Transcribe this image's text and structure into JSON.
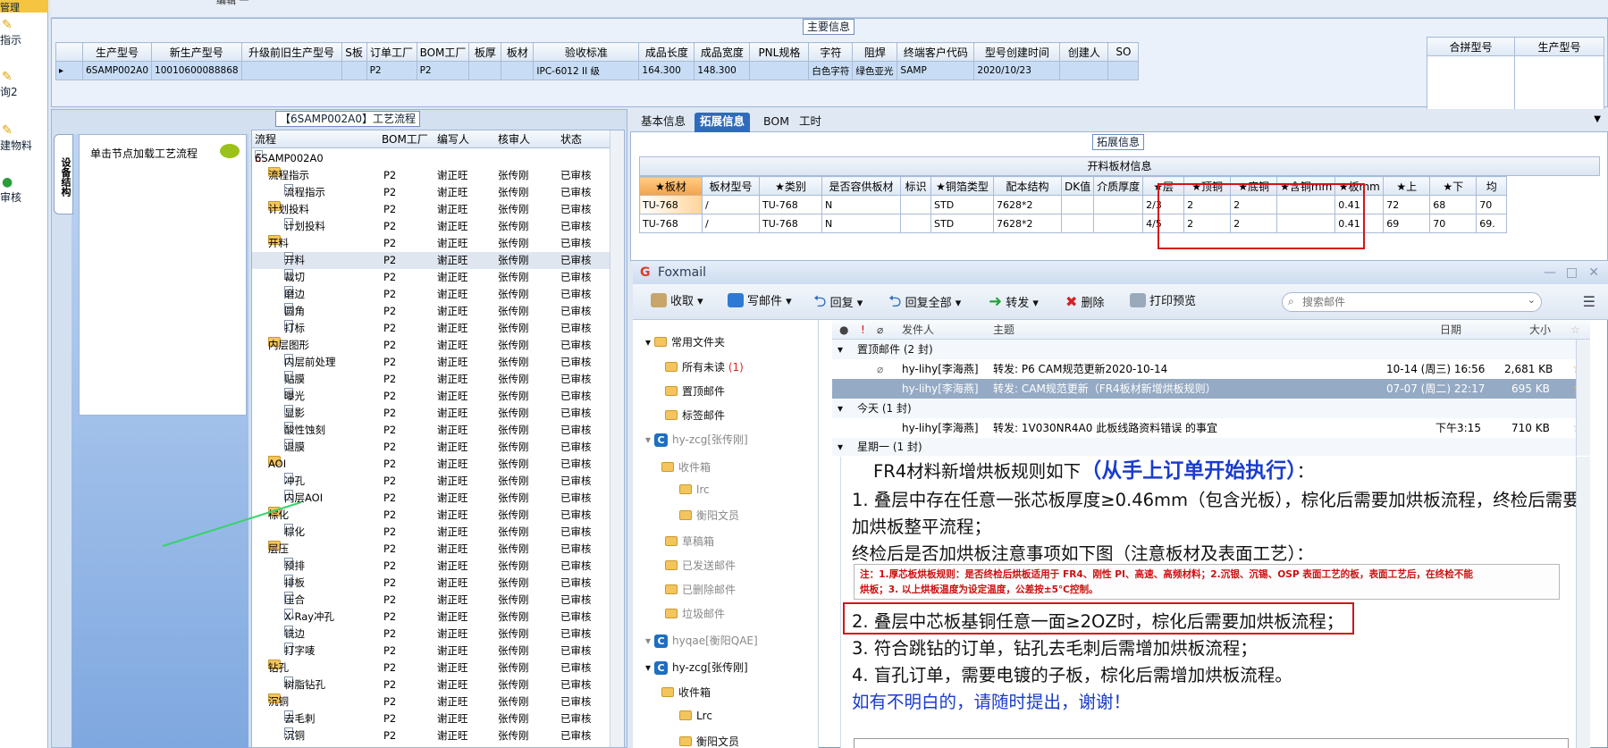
{
  "leftbar": {
    "items": [
      "管理",
      "指示",
      "询2",
      "建物料",
      "审核"
    ]
  },
  "top_sample_text": "编辑 一",
  "main_header": {
    "group_title": "主要信息",
    "columns": [
      "生产型号",
      "新生产型号",
      "升级前旧生产型号",
      "S板",
      "订单工厂",
      "BOM工厂",
      "板厚",
      "板材",
      "验收标准",
      "成品长度",
      "成品宽度",
      "PNL规格",
      "字符",
      "阻焊",
      "终端客户代码",
      "型号创建时间",
      "创建人",
      "SO"
    ],
    "row": [
      "6SAMP002A0",
      "10010600088868",
      "",
      "",
      "P2",
      "P2",
      "",
      "",
      "IPC-6012 II 级",
      "164.300",
      "148.300",
      "",
      "白色字符",
      "绿色亚光",
      "SAMP",
      "2020/10/23",
      "",
      ""
    ],
    "right_columns": [
      "合拼型号",
      "生产型号"
    ]
  },
  "process": {
    "group_title": "【6SAMP002A0】工艺流程",
    "vtab_label": "设备结构",
    "hint": "单击节点加载工艺流程",
    "columns": [
      "流程",
      "BOM工厂",
      "编写人",
      "核审人",
      "状态"
    ],
    "root": "6SAMP002A0",
    "rows": [
      {
        "name": "流程指示",
        "level": 1,
        "bom": "P2",
        "writer": "谢正旺",
        "reviewer": "张传刚",
        "status": "已审核"
      },
      {
        "name": "流程指示",
        "level": 2,
        "bom": "P2",
        "writer": "谢正旺",
        "reviewer": "张传刚",
        "status": "已审核"
      },
      {
        "name": "计划投料",
        "level": 1,
        "bom": "P2",
        "writer": "谢正旺",
        "reviewer": "张传刚",
        "status": "已审核"
      },
      {
        "name": "计划投料",
        "level": 2,
        "bom": "P2",
        "writer": "谢正旺",
        "reviewer": "张传刚",
        "status": "已审核"
      },
      {
        "name": "开料",
        "level": 1,
        "bom": "P2",
        "writer": "谢正旺",
        "reviewer": "张传刚",
        "status": "已审核"
      },
      {
        "name": "开料",
        "level": 2,
        "bom": "P2",
        "writer": "谢正旺",
        "reviewer": "张传刚",
        "status": "已审核"
      },
      {
        "name": "裁切",
        "level": 2,
        "bom": "P2",
        "writer": "谢正旺",
        "reviewer": "张传刚",
        "status": "已审核"
      },
      {
        "name": "磨边",
        "level": 2,
        "bom": "P2",
        "writer": "谢正旺",
        "reviewer": "张传刚",
        "status": "已审核"
      },
      {
        "name": "圆角",
        "level": 2,
        "bom": "P2",
        "writer": "谢正旺",
        "reviewer": "张传刚",
        "status": "已审核"
      },
      {
        "name": "打标",
        "level": 2,
        "bom": "P2",
        "writer": "谢正旺",
        "reviewer": "张传刚",
        "status": "已审核"
      },
      {
        "name": "内层图形",
        "level": 1,
        "bom": "P2",
        "writer": "谢正旺",
        "reviewer": "张传刚",
        "status": "已审核"
      },
      {
        "name": "内层前处理",
        "level": 2,
        "bom": "P2",
        "writer": "谢正旺",
        "reviewer": "张传刚",
        "status": "已审核"
      },
      {
        "name": "贴膜",
        "level": 2,
        "bom": "P2",
        "writer": "谢正旺",
        "reviewer": "张传刚",
        "status": "已审核"
      },
      {
        "name": "曝光",
        "level": 2,
        "bom": "P2",
        "writer": "谢正旺",
        "reviewer": "张传刚",
        "status": "已审核"
      },
      {
        "name": "显影",
        "level": 2,
        "bom": "P2",
        "writer": "谢正旺",
        "reviewer": "张传刚",
        "status": "已审核"
      },
      {
        "name": "酸性蚀刻",
        "level": 2,
        "bom": "P2",
        "writer": "谢正旺",
        "reviewer": "张传刚",
        "status": "已审核"
      },
      {
        "name": "退膜",
        "level": 2,
        "bom": "P2",
        "writer": "谢正旺",
        "reviewer": "张传刚",
        "status": "已审核"
      },
      {
        "name": "AOI",
        "level": 1,
        "bom": "P2",
        "writer": "谢正旺",
        "reviewer": "张传刚",
        "status": "已审核"
      },
      {
        "name": "冲孔",
        "level": 2,
        "bom": "P2",
        "writer": "谢正旺",
        "reviewer": "张传刚",
        "status": "已审核"
      },
      {
        "name": "内层AOI",
        "level": 2,
        "bom": "P2",
        "writer": "谢正旺",
        "reviewer": "张传刚",
        "status": "已审核"
      },
      {
        "name": "棕化",
        "level": 1,
        "bom": "P2",
        "writer": "谢正旺",
        "reviewer": "张传刚",
        "status": "已审核"
      },
      {
        "name": "棕化",
        "level": 2,
        "bom": "P2",
        "writer": "谢正旺",
        "reviewer": "张传刚",
        "status": "已审核"
      },
      {
        "name": "层压",
        "level": 1,
        "bom": "P2",
        "writer": "谢正旺",
        "reviewer": "张传刚",
        "status": "已审核"
      },
      {
        "name": "预排",
        "level": 2,
        "bom": "P2",
        "writer": "谢正旺",
        "reviewer": "张传刚",
        "status": "已审核"
      },
      {
        "name": "排板",
        "level": 2,
        "bom": "P2",
        "writer": "谢正旺",
        "reviewer": "张传刚",
        "status": "已审核"
      },
      {
        "name": "压合",
        "level": 2,
        "bom": "P2",
        "writer": "谢正旺",
        "reviewer": "张传刚",
        "status": "已审核"
      },
      {
        "name": "X-Ray冲孔",
        "level": 2,
        "bom": "P2",
        "writer": "谢正旺",
        "reviewer": "张传刚",
        "status": "已审核"
      },
      {
        "name": "铣边",
        "level": 2,
        "bom": "P2",
        "writer": "谢正旺",
        "reviewer": "张传刚",
        "status": "已审核"
      },
      {
        "name": "打字唛",
        "level": 2,
        "bom": "P2",
        "writer": "谢正旺",
        "reviewer": "张传刚",
        "status": "已审核"
      },
      {
        "name": "钻孔",
        "level": 1,
        "bom": "P2",
        "writer": "谢正旺",
        "reviewer": "张传刚",
        "status": "已审核"
      },
      {
        "name": "树脂钻孔",
        "level": 2,
        "bom": "P2",
        "writer": "谢正旺",
        "reviewer": "张传刚",
        "status": "已审核"
      },
      {
        "name": "沉铜",
        "level": 1,
        "bom": "P2",
        "writer": "谢正旺",
        "reviewer": "张传刚",
        "status": "已审核"
      },
      {
        "name": "去毛刺",
        "level": 2,
        "bom": "P2",
        "writer": "谢正旺",
        "reviewer": "张传刚",
        "status": "已审核"
      },
      {
        "name": "沉铜",
        "level": 2,
        "bom": "P2",
        "writer": "谢正旺",
        "reviewer": "张传刚",
        "status": "已审核"
      }
    ]
  },
  "ext": {
    "tabs": [
      "基本信息",
      "拓展信息",
      "BOM",
      "工时"
    ],
    "active_tab": "拓展信息",
    "group_title": "拓展信息",
    "table_title": "开料板材信息",
    "columns": [
      "★板材",
      "板材型号",
      "★类别",
      "是否容供板材",
      "标识",
      "★铜箔类型",
      "配本结构",
      "DK值",
      "介质厚度",
      "★层",
      "★顶铜",
      "★底铜",
      "★含铜mm",
      "★板mm",
      "★上",
      "★下",
      "均"
    ],
    "rows": [
      [
        "TU-768",
        "/",
        "TU-768",
        "N",
        "",
        "STD",
        "7628*2",
        "",
        "",
        "2/3",
        "2",
        "2",
        "",
        "0.41",
        "72",
        "68",
        "70"
      ],
      [
        "TU-768",
        "/",
        "TU-768",
        "N",
        "",
        "STD",
        "7628*2",
        "",
        "",
        "4/5",
        "2",
        "2",
        "",
        "0.41",
        "69",
        "70",
        "69."
      ]
    ]
  },
  "foxmail": {
    "title": "Foxmail",
    "toolbar": [
      "收取",
      "写邮件",
      "回复",
      "回复全部",
      "转发",
      "删除",
      "打印预览"
    ],
    "search_placeholder": "搜索邮件",
    "folders": [
      {
        "label": "常用文件夹",
        "kind": "group"
      },
      {
        "label": "所有未读",
        "count": "(1)"
      },
      {
        "label": "置顶邮件"
      },
      {
        "label": "标签邮件"
      },
      {
        "label": "hy-zcg[张传刚]",
        "kind": "account"
      },
      {
        "label": "收件箱"
      },
      {
        "label": "lrc"
      },
      {
        "label": "衡阳文员"
      },
      {
        "label": "草稿箱"
      },
      {
        "label": "已发送邮件"
      },
      {
        "label": "已删除邮件"
      },
      {
        "label": "垃圾邮件"
      },
      {
        "label": "hyqae[衡阳QAE]",
        "kind": "account"
      },
      {
        "label": "hy-zcg[张传刚]",
        "kind": "account"
      },
      {
        "label": "收件箱"
      },
      {
        "label": "Lrc"
      },
      {
        "label": "衡阳文员"
      }
    ],
    "list_headers": {
      "sender": "发件人",
      "subject": "主题",
      "date": "日期",
      "size": "大小"
    },
    "groups": [
      "置顶邮件 (2 封)",
      "今天 (1 封)",
      "星期一 (1 封)"
    ],
    "mails": [
      {
        "sender": "hy-lihy[李海燕]",
        "subject": "转发: P6 CAM规范更新2020-10-14",
        "date": "10-14 (周三) 16:56",
        "size": "2,681 KB"
      },
      {
        "sender": "hy-lihy[李海燕]",
        "subject": "转发: CAM规范更新（FR4板材新增烘板规则）",
        "date": "07-07 (周二) 22:17",
        "size": "695 KB"
      },
      {
        "sender": "hy-lihy[李海燕]",
        "subject": "转发: 1V030NR4A0  此板线路资料错误 的事宜",
        "date": "下午3:15",
        "size": "710 KB"
      }
    ],
    "preview": {
      "heading_pre": "FR4材料新增烘板规则如下",
      "heading_emph": "（从手上订单开始执行）",
      "heading_post": "：",
      "line1a": "1. 叠层中存在任意一张芯板厚度≥0.46mm（包含光板），棕化后需要加烘板流程，终检后需要",
      "line1b": "加烘板整平流程；",
      "line1c": "终检后是否加烘板注意事项如下图（注意板材及表面工艺）：",
      "note1": "注：1.厚芯板烘板规则：是否终检后烘板适用于 FR4、刚性 PI、高速、高频材料；2.沉银、沉锡、OSP 表面工艺的板，表面工艺后，在终检不能",
      "note2": "烘板；3. 以上烘板温度为设定温度，公差按±5℃控制。",
      "line2": "2. 叠层中芯板基铜任意一面≥2OZ时，棕化后需要加烘板流程；",
      "line3": "3. 符合跳钻的订单，钻孔去毛刺后需增加烘板流程；",
      "line4": "4. 盲孔订单，需要电镀的子板，棕化后需增加烘板流程。",
      "line5": "如有不明白的，请随时提出，谢谢！"
    }
  }
}
